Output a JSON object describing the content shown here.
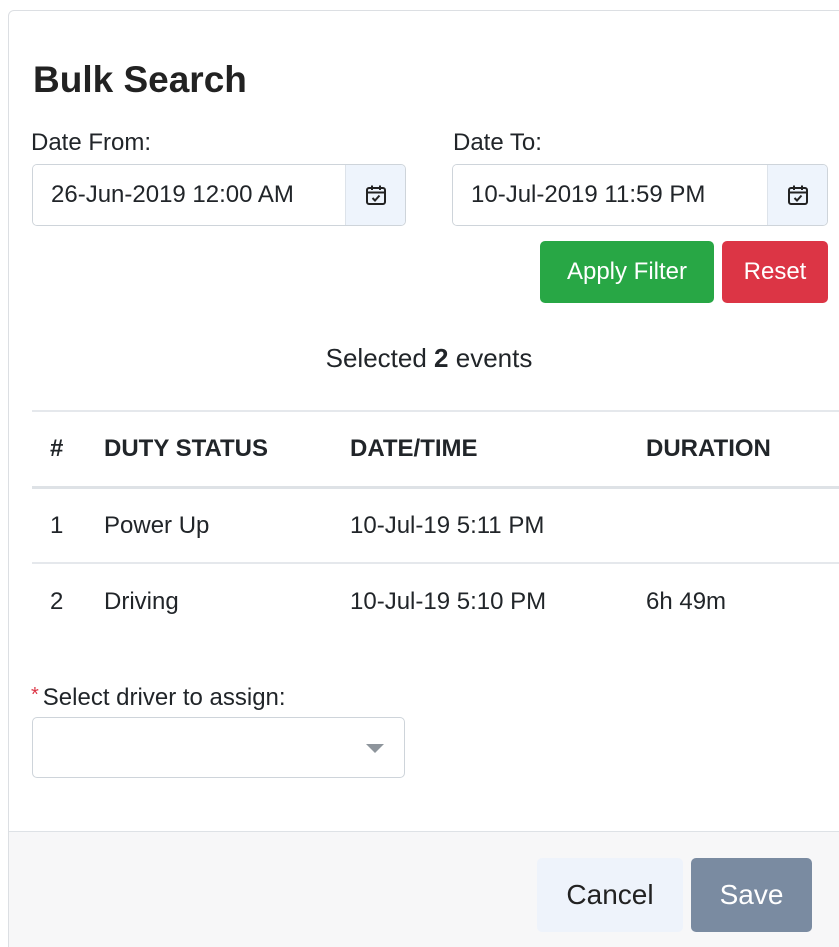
{
  "modal": {
    "title": "Bulk Search"
  },
  "filters": {
    "date_from": {
      "label": "Date From:",
      "value": "26-Jun-2019 12:00 AM"
    },
    "date_to": {
      "label": "Date To:",
      "value": "10-Jul-2019 11:59 PM"
    },
    "apply_label": "Apply Filter",
    "reset_label": "Reset"
  },
  "summary": {
    "prefix": "Selected",
    "count": "2",
    "suffix": "events"
  },
  "table": {
    "headers": [
      "#",
      "DUTY STATUS",
      "DATE/TIME",
      "DURATION"
    ],
    "rows": [
      [
        "1",
        "Power Up",
        "10-Jul-19 5:11 PM",
        ""
      ],
      [
        "2",
        "Driving",
        "10-Jul-19 5:10 PM",
        "6h 49m"
      ]
    ]
  },
  "driver": {
    "required_marker": "*",
    "label": "Select driver to assign:",
    "value": ""
  },
  "footer": {
    "cancel_label": "Cancel",
    "save_label": "Save"
  },
  "colors": {
    "apply": "#28a745",
    "reset": "#dc3545",
    "save": "#7a8ba1",
    "required": "#dc3545"
  },
  "icons": {
    "calendar": "calendar-check-icon",
    "caret": "chevron-down-icon"
  }
}
